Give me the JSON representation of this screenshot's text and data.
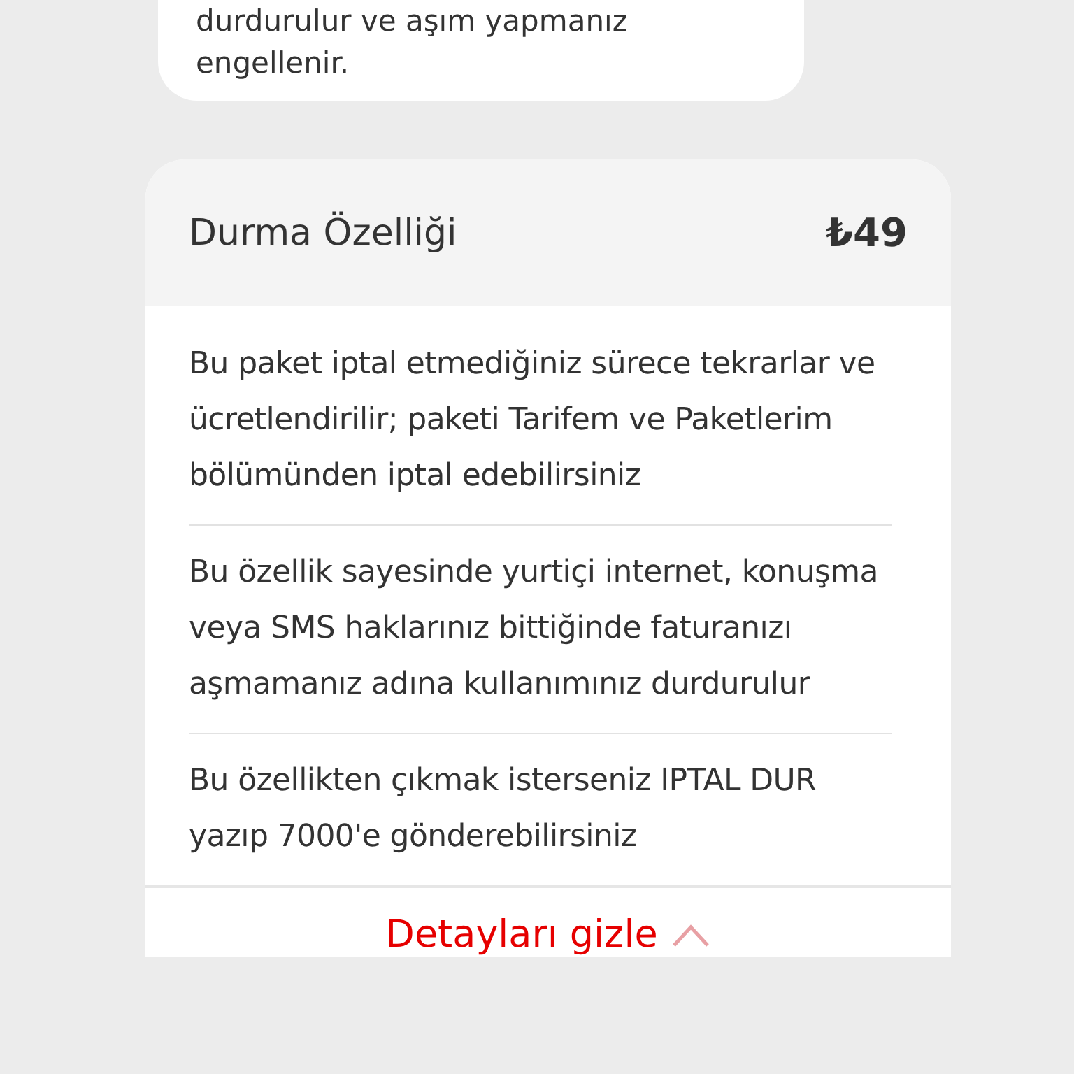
{
  "previous_card": {
    "lines": [
      "durdurulur ve aşım yapmanız",
      "engellenir."
    ]
  },
  "feature_card": {
    "title": "Durma Özelliği",
    "price": "₺49",
    "paragraphs": [
      "Bu paket iptal etmediğiniz sürece tekrarlar ve ücretlendirilir; paketi Tarifem ve Paketlerim bölümünden iptal edebilirsiniz",
      "Bu özellik sayesinde yurtiçi internet, konuşma veya SMS haklarınız bittiğinde faturanızı aşmamanız adına kullanımınız durdurulur",
      "Bu özellikten çıkmak isterseniz IPTAL DUR yazıp 7000'e gönderebilirsiniz"
    ],
    "toggle": {
      "label": "Detayları gizle",
      "expanded": true
    }
  }
}
